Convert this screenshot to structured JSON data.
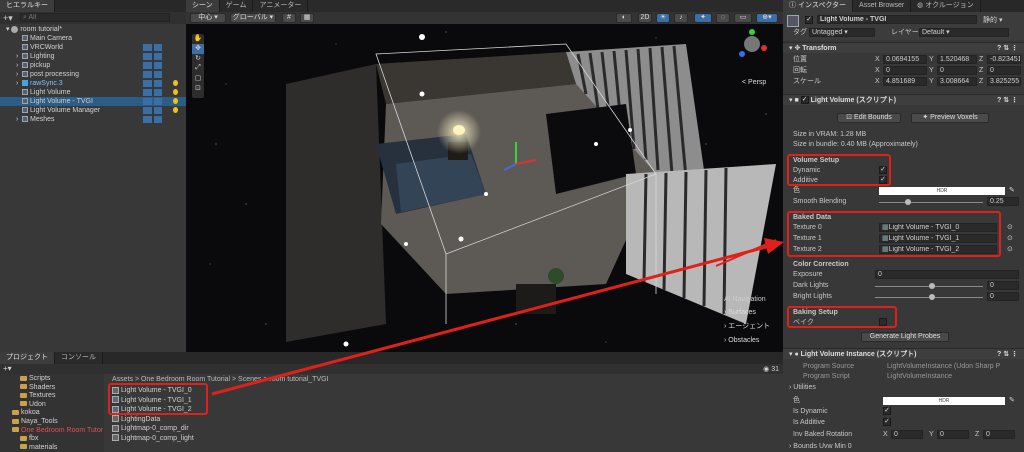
{
  "hierarchy": {
    "tab": "ヒエラルキー",
    "search_placeholder": "All",
    "scene": "room tutorial*",
    "items": [
      {
        "label": "Main Camera",
        "indent": 1
      },
      {
        "label": "VRCWorld",
        "indent": 1
      },
      {
        "label": "Lighting",
        "indent": 1
      },
      {
        "label": "pickup",
        "indent": 1
      },
      {
        "label": "post processing",
        "indent": 1
      },
      {
        "label": "rawSync.3",
        "indent": 1
      },
      {
        "label": "Light Volume",
        "indent": 1
      },
      {
        "label": "Light Volume - TVGI",
        "indent": 1
      },
      {
        "label": "Light Volume Manager",
        "indent": 1
      },
      {
        "label": "Meshes",
        "indent": 1
      }
    ]
  },
  "scene_view": {
    "tabs": [
      "シーン",
      "ゲーム",
      "アニメーター"
    ],
    "pivot_label": "中心",
    "space_label": "グローバル",
    "mode_2d": "2D",
    "persp_label": "< Persp",
    "ai_nav": {
      "title": "AI Navigation",
      "items": [
        "Surfaces",
        "エージェント",
        "Obstacles"
      ]
    }
  },
  "project": {
    "tabs": [
      "プロジェクト",
      "コンソール"
    ],
    "tree": [
      "Scripts",
      "Shaders",
      "Textures",
      "Udon",
      "kokoa",
      "Naya_Tools",
      "One Bedroom Room Tutor",
      "fbx",
      "materials"
    ],
    "breadcrumb": "Assets > One Bedroom Room Tutorial > Scenes > room tutorial_TVGI",
    "count": "31",
    "files": [
      "Light Volume - TVGI_0",
      "Light Volume - TVGI_1",
      "Light Volume - TVGI_2",
      "LightingData",
      "Lightmap-0_comp_dir",
      "Lightmap-0_comp_light"
    ]
  },
  "inspector": {
    "tabs": [
      "インスペクター",
      "Asset Browser",
      "オクルージョン"
    ],
    "object_name": "Light Volume - TVGI",
    "static_label": "静的",
    "tag_label": "タグ",
    "tag_value": "Untagged",
    "layer_label": "レイヤー",
    "layer_value": "Default",
    "transform": {
      "title": "Transform",
      "rows": [
        {
          "label": "位置",
          "x": "0.0694155",
          "y": "1.520468",
          "z": "-0.823451"
        },
        {
          "label": "回転",
          "x": "0",
          "y": "0",
          "z": "0"
        },
        {
          "label": "スケール",
          "x": "4.851689",
          "y": "3.008664",
          "z": "3.825255"
        }
      ]
    },
    "light_volume": {
      "title": "Light Volume (スクリプト)",
      "edit_bounds": "Edit Bounds",
      "preview_voxels": "Preview Voxels",
      "vram": "Size in VRAM: 1.28 MB",
      "bundle": "Size in bundle: 0.40 MB (Approximately)",
      "volume_setup": "Volume Setup",
      "dynamic": "Dynamic",
      "additive": "Additive",
      "color_label": "色",
      "hdr": "HDR",
      "smooth_blending": "Smooth Blending",
      "smooth_value": "0.25",
      "baked_data": "Baked Data",
      "textures": [
        {
          "label": "Texture 0",
          "value": "Light Volume - TVGI_0"
        },
        {
          "label": "Texture 1",
          "value": "Light Volume - TVGI_1"
        },
        {
          "label": "Texture 2",
          "value": "Light Volume - TVGI_2"
        }
      ],
      "color_correction": "Color Correction",
      "exposure": "Exposure",
      "exposure_value": "0",
      "dark_lights": "Dark Lights",
      "dark_value": "0",
      "bright_lights": "Bright Lights",
      "bright_value": "0",
      "baking_setup": "Baking Setup",
      "bake_label": "ベイク",
      "generate_button": "Generate Light Probes"
    },
    "instance": {
      "title": "Light Volume Instance (スクリプト)",
      "program_source_label": "Program Source",
      "program_source": "LightVolumeInstance (Udon Sharp P",
      "program_script_label": "Program Script",
      "program_script": "LightVolumeInstance",
      "utilities": "Utilities",
      "color_label": "色",
      "hdr": "HDR",
      "is_dynamic": "Is Dynamic",
      "is_additive": "Is Additive",
      "inv_baked_rotation": "Inv Baked Rotation",
      "rot": {
        "x": "0",
        "y": "0",
        "z": "0"
      },
      "bounds_min": "Bounds Uvw Min 0"
    }
  },
  "colors": {
    "highlight": "#e0211b",
    "selection": "#2c5d87",
    "panel": "#383838"
  }
}
